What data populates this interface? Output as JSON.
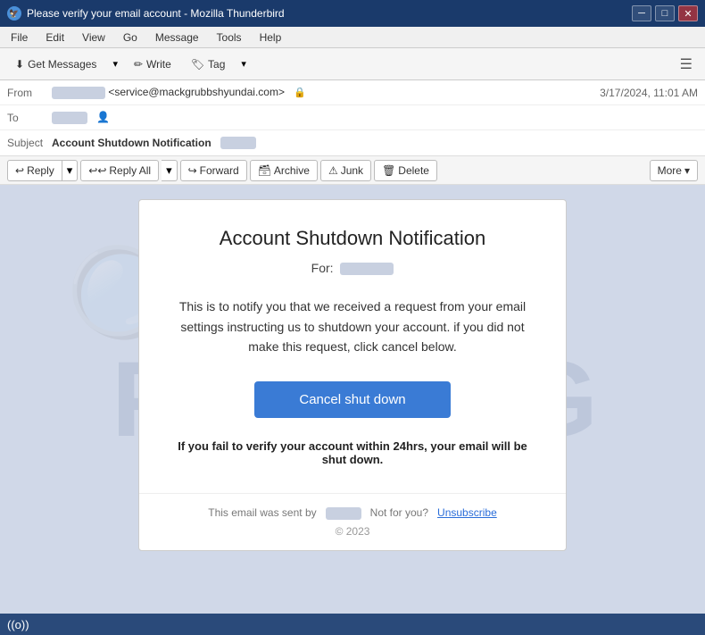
{
  "titleBar": {
    "title": "Please verify your email account - Mozilla Thunderbird",
    "icon": "🦅",
    "minimizeBtn": "─",
    "maximizeBtn": "□",
    "closeBtn": "✕"
  },
  "menuBar": {
    "items": [
      "File",
      "Edit",
      "View",
      "Go",
      "Message",
      "Tools",
      "Help"
    ]
  },
  "toolbar": {
    "getMessages": "Get Messages",
    "write": "Write",
    "tag": "Tag",
    "menuIcon": "☰"
  },
  "emailHeader": {
    "fromLabel": "From",
    "fromName": "██████",
    "fromEmail": "<service@mackgrubbshyundai.com>",
    "toLabel": "To",
    "subjectLabel": "Subject",
    "subjectText": "Please verify your email account",
    "subjectBlurred": "██████",
    "date": "3/17/2024, 11:01 AM"
  },
  "actionBar": {
    "reply": "Reply",
    "replyAll": "Reply All",
    "forward": "Forward",
    "archive": "Archive",
    "junk": "Junk",
    "delete": "Delete",
    "more": "More"
  },
  "emailCard": {
    "title": "Account Shutdown Notification",
    "forLabel": "For:",
    "forValue": "██████",
    "bodyText": "This is to notify you that we received a request from your email settings instructing us to shutdown your account. if you did not make this request, click cancel below.",
    "cancelBtn": "Cancel shut down",
    "warningText": "If you fail to verify your account within 24hrs, your email will be shut down.",
    "footerSentBy": "This email was sent by",
    "footerSender": "██████",
    "footerNotFor": "Not for you?",
    "footerUnsubscribe": "Unsubscribe",
    "copyright": "© 2023"
  },
  "statusBar": {
    "wifiLabel": "((o))"
  }
}
